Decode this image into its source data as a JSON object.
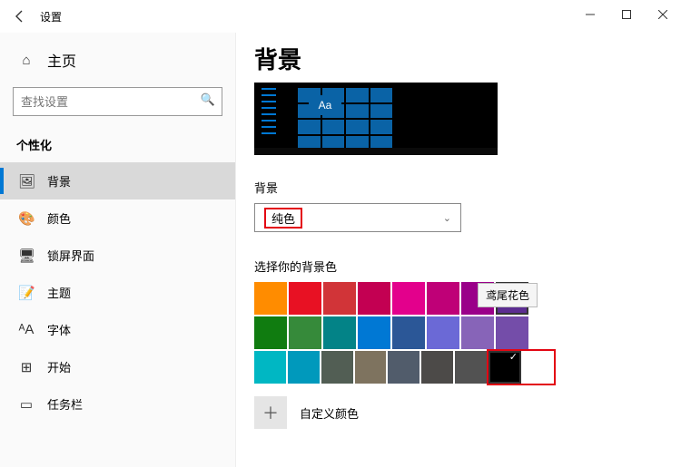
{
  "window": {
    "title": "设置"
  },
  "sidebar": {
    "home": "主页",
    "search_placeholder": "查找设置",
    "section": "个性化",
    "items": [
      {
        "icon": "🖼",
        "label": "背景",
        "active": true
      },
      {
        "icon": "🎨",
        "label": "颜色"
      },
      {
        "icon": "🖥",
        "label": "锁屏界面"
      },
      {
        "icon": "📝",
        "label": "主题"
      },
      {
        "icon": "ᴬA",
        "label": "字体"
      },
      {
        "icon": "⊞",
        "label": "开始"
      },
      {
        "icon": "▭",
        "label": "任务栏"
      }
    ]
  },
  "page": {
    "title": "背景",
    "preview_sample": "Aa",
    "bg_label": "背景",
    "bg_value": "纯色",
    "choose_label": "选择你的背景色",
    "tooltip": "鸢尾花色",
    "custom_label": "自定义颜色",
    "colors": [
      [
        "#ff8c00",
        "#e81123",
        "#d13438",
        "#c30052",
        "#e3008c",
        "#bf0077",
        "#9a0089",
        "#5c2d91"
      ],
      [
        "#107c10",
        "#368a3a",
        "#038387",
        "#0078d4",
        "#2b5797",
        "#6b69d6",
        "#8764b8",
        "#744da9"
      ],
      [
        "#00b7c3",
        "#0099bc",
        "#525e54",
        "#7e735f",
        "#515c6b",
        "#4c4a48",
        "#525252",
        "#000000"
      ]
    ],
    "selected": {
      "row": 0,
      "col": 7
    },
    "checked": {
      "row": 2,
      "col": 7
    },
    "extra_white": "#ffffff"
  }
}
